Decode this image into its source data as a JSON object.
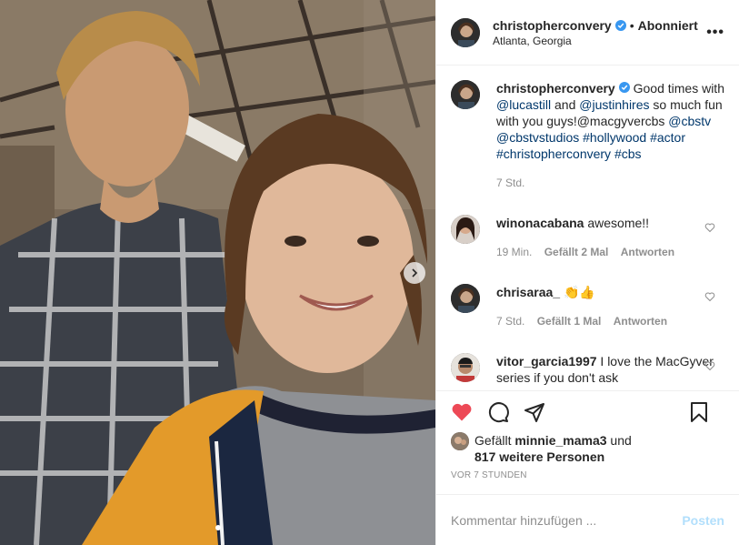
{
  "post": {
    "author": "christopherconvery",
    "follow_status": "Abonniert",
    "separator": "•",
    "location": "Atlanta, Georgia",
    "more_glyph": "•••"
  },
  "caption": {
    "username": "christopherconvery",
    "text_1": " Good times with ",
    "mention_1": "@lucastill",
    "text_2": " and ",
    "mention_2": "@justinhires",
    "text_3": " so much fun with you guys!@macgyvercbs ",
    "mention_3": "@cbstv",
    "mention_4": "@cbstvstudios",
    "tag_1": "#hollywood",
    "tag_2": "#actor",
    "tag_3": "#christopherconvery",
    "tag_4": "#cbs",
    "time": "7 Std."
  },
  "comments": [
    {
      "username": "winonacabana",
      "text": "awesome!!",
      "time": "19 Min.",
      "likes": "Gefällt 2 Mal",
      "reply": "Antworten"
    },
    {
      "username": "chrisaraa_",
      "text": "👏👍",
      "time": "7 Std.",
      "likes": "Gefällt 1 Mal",
      "reply": "Antworten"
    },
    {
      "username": "vitor_garcia1997",
      "text": "I love the MacGyver series if you don't ask"
    }
  ],
  "likes_line": {
    "prefix": "Gefällt ",
    "user": "minnie_mama3",
    "suffix": " und",
    "others": "817 weitere Personen"
  },
  "timestamp": "VOR 7 STUNDEN",
  "comment_box": {
    "placeholder": "Kommentar hinzufügen ...",
    "post_label": "Posten"
  },
  "colors": {
    "like_red": "#ed4956",
    "link_blue": "#00376b",
    "verified_blue": "#3897f0",
    "post_disabled": "#b2dffc"
  },
  "icons": [
    "verified-badge-icon",
    "more-options-icon",
    "heart-icon",
    "comment-icon",
    "share-icon",
    "bookmark-icon",
    "carousel-next-icon"
  ]
}
